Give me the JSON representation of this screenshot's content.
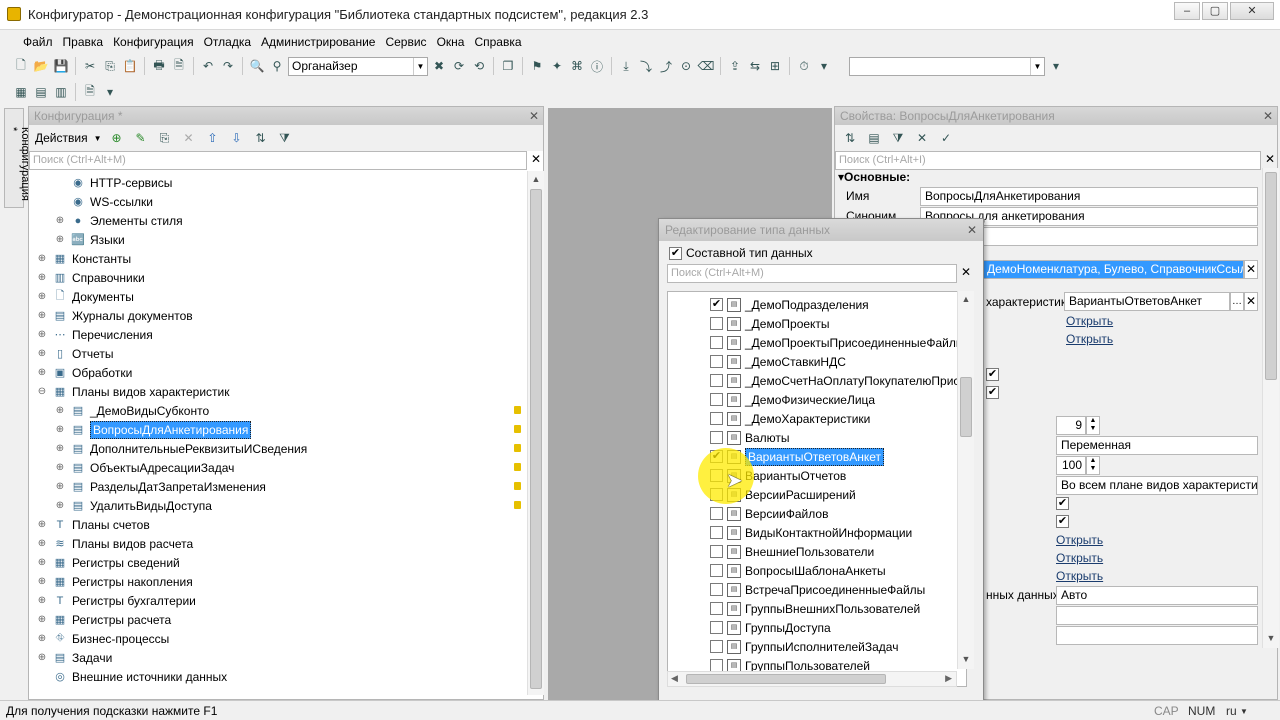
{
  "window": {
    "title": "Конфигуратор - Демонстрационная конфигурация \"Библиотека стандартных подсистем\", редакция 2.3"
  },
  "menu": [
    "Файл",
    "Правка",
    "Конфигурация",
    "Отладка",
    "Администрирование",
    "Сервис",
    "Окна",
    "Справка"
  ],
  "toolbar": {
    "search_combo": "Органайзер"
  },
  "left_panel": {
    "title": "Конфигурация *",
    "side_tab": "Конфигурация *",
    "actions_label": "Действия",
    "search_placeholder": "Поиск (Ctrl+Alt+M)",
    "tree": [
      {
        "label": "HTTP-сервисы",
        "level": 2,
        "expander": ""
      },
      {
        "label": "WS-ссылки",
        "level": 2,
        "expander": ""
      },
      {
        "label": "Элементы стиля",
        "level": 2,
        "expander": "⊕"
      },
      {
        "label": "Языки",
        "level": 2,
        "expander": "⊕"
      },
      {
        "label": "Константы",
        "level": 1,
        "expander": "⊕"
      },
      {
        "label": "Справочники",
        "level": 1,
        "expander": "⊕"
      },
      {
        "label": "Документы",
        "level": 1,
        "expander": "⊕"
      },
      {
        "label": "Журналы документов",
        "level": 1,
        "expander": "⊕"
      },
      {
        "label": "Перечисления",
        "level": 1,
        "expander": "⊕"
      },
      {
        "label": "Отчеты",
        "level": 1,
        "expander": "⊕"
      },
      {
        "label": "Обработки",
        "level": 1,
        "expander": "⊕"
      },
      {
        "label": "Планы видов характеристик",
        "level": 1,
        "expander": "⊖"
      },
      {
        "label": "_ДемоВидыСубконто",
        "level": 2,
        "expander": "⊕",
        "locked": true
      },
      {
        "label": "ВопросыДляАнкетирования",
        "level": 2,
        "expander": "⊕",
        "locked": true,
        "selected": true
      },
      {
        "label": "ДополнительныеРеквизитыИСведения",
        "level": 2,
        "expander": "⊕",
        "locked": true
      },
      {
        "label": "ОбъектыАдресацииЗадач",
        "level": 2,
        "expander": "⊕",
        "locked": true
      },
      {
        "label": "РазделыДатЗапретаИзменения",
        "level": 2,
        "expander": "⊕",
        "locked": true
      },
      {
        "label": "УдалитьВидыДоступа",
        "level": 2,
        "expander": "⊕",
        "locked": true
      },
      {
        "label": "Планы счетов",
        "level": 1,
        "expander": "⊕"
      },
      {
        "label": "Планы видов расчета",
        "level": 1,
        "expander": "⊕"
      },
      {
        "label": "Регистры сведений",
        "level": 1,
        "expander": "⊕"
      },
      {
        "label": "Регистры накопления",
        "level": 1,
        "expander": "⊕"
      },
      {
        "label": "Регистры бухгалтерии",
        "level": 1,
        "expander": "⊕"
      },
      {
        "label": "Регистры расчета",
        "level": 1,
        "expander": "⊕"
      },
      {
        "label": "Бизнес-процессы",
        "level": 1,
        "expander": "⊕"
      },
      {
        "label": "Задачи",
        "level": 1,
        "expander": "⊕"
      },
      {
        "label": "Внешние источники данных",
        "level": 1,
        "expander": ""
      }
    ]
  },
  "right_panel": {
    "title": "Свойства: ВопросыДляАнкетирования",
    "search_placeholder": "Поиск (Ctrl+Alt+I)",
    "section": "Основные:",
    "name_label": "Имя",
    "name_value": "ВопросыДляАнкетирования",
    "synonym_label": "Синоним",
    "synonym_value": "Вопросы для анкетирования",
    "type_value": "ДемоНоменклатура, Булево, СправочникСсылка._Де",
    "char_label": "характеристик",
    "char_value": "ВариантыОтветовАнкет",
    "open1": "Открыть",
    "open2": "Открыть",
    "num1": "9",
    "variable": "Переменная",
    "num2": "100",
    "scope": "Во всем плане видов характеристик",
    "open3": "Открыть",
    "open4": "Открыть",
    "open5": "Открыть",
    "data_label": "нных данных",
    "auto": "Авто"
  },
  "dialog": {
    "title": "Редактирование типа данных",
    "composite_label": "Составной тип данных",
    "search_placeholder": "Поиск (Ctrl+Alt+M)",
    "items": [
      {
        "label": "_ДемоПодразделения",
        "checked": true
      },
      {
        "label": "_ДемоПроекты",
        "checked": false
      },
      {
        "label": "_ДемоПроектыПрисоединенныеФайлы",
        "checked": false
      },
      {
        "label": "_ДемоСтавкиНДС",
        "checked": false
      },
      {
        "label": "_ДемоСчетНаОплатуПокупателюПрисоеди",
        "checked": false
      },
      {
        "label": "_ДемоФизическиеЛица",
        "checked": false
      },
      {
        "label": "_ДемоХарактеристики",
        "checked": false
      },
      {
        "label": "Валюты",
        "checked": false
      },
      {
        "label": "ВариантыОтветовАнкет",
        "checked": true,
        "selected": true
      },
      {
        "label": "ВариантыОтчетов",
        "checked": false
      },
      {
        "label": "ВерсииРасширений",
        "checked": false
      },
      {
        "label": "ВерсииФайлов",
        "checked": false
      },
      {
        "label": "ВидыКонтактнойИнформации",
        "checked": false
      },
      {
        "label": "ВнешниеПользователи",
        "checked": false
      },
      {
        "label": "ВопросыШаблонаАнкеты",
        "checked": false
      },
      {
        "label": "ВстречаПрисоединенныеФайлы",
        "checked": false
      },
      {
        "label": "ГруппыВнешнихПользователей",
        "checked": false
      },
      {
        "label": "ГруппыДоступа",
        "checked": false
      },
      {
        "label": "ГруппыИсполнителейЗадач",
        "checked": false
      },
      {
        "label": "ГруппыПользователей",
        "checked": false
      }
    ]
  },
  "status": {
    "hint": "Для получения подсказки нажмите F1",
    "cap": "CAP",
    "num": "NUM",
    "lang": "ru"
  },
  "colors": {
    "selection": "#3399ff",
    "highlight": "#ffeb00"
  }
}
